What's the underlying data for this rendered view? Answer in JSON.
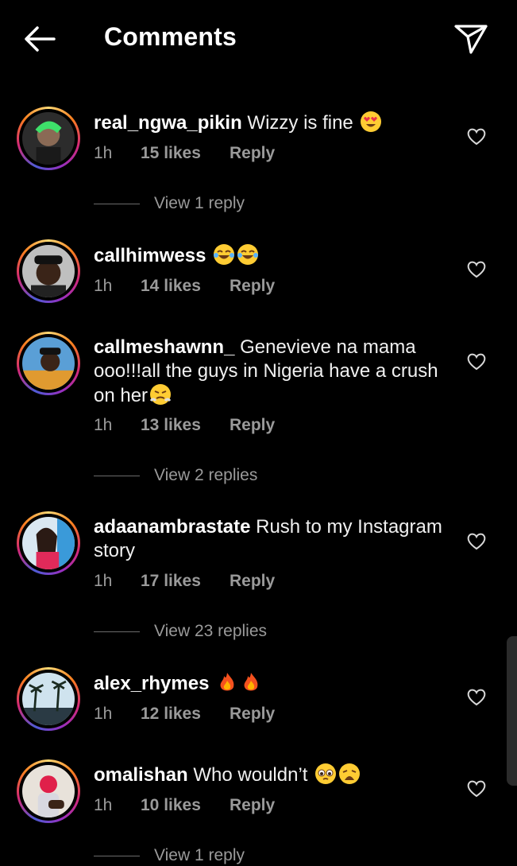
{
  "header": {
    "title": "Comments",
    "back_icon": "arrow-left-icon",
    "share_icon": "send-icon"
  },
  "comments": [
    {
      "username": "real_ngwa_pikin",
      "text": "Wizzy is fine",
      "emojis": [
        "heart-eyes-emoji"
      ],
      "time": "1h",
      "likes": "15 likes",
      "reply": "Reply",
      "view_replies": "View 1 reply"
    },
    {
      "username": "callhimwess",
      "text": "",
      "emojis": [
        "tears-of-joy-emoji",
        "tears-of-joy-emoji"
      ],
      "time": "1h",
      "likes": "14 likes",
      "reply": "Reply"
    },
    {
      "username": "callmeshawnn_",
      "text": "Genevieve na mama ooo!!!all the guys in Nigeria have a crush on her",
      "emojis": [
        "steam-from-nose-emoji"
      ],
      "time": "1h",
      "likes": "13 likes",
      "reply": "Reply",
      "view_replies": "View 2 replies"
    },
    {
      "username": "adaanambrastate",
      "text": "Rush to my Instagram story",
      "emojis": [],
      "time": "1h",
      "likes": "17 likes",
      "reply": "Reply",
      "view_replies": "View 23 replies"
    },
    {
      "username": "alex_rhymes",
      "text": "",
      "emojis": [
        "fire-emoji",
        "fire-emoji"
      ],
      "time": "1h",
      "likes": "12 likes",
      "reply": "Reply"
    },
    {
      "username": "omalishan",
      "text": "Who wouldn’t",
      "emojis": [
        "pleading-face-emoji",
        "weary-face-emoji"
      ],
      "time": "1h",
      "likes": "10 likes",
      "reply": "Reply",
      "view_replies": "View 1 reply"
    }
  ],
  "colors": {
    "background": "#000000",
    "text": "#f5f5f5",
    "muted": "#9a9a9a"
  }
}
